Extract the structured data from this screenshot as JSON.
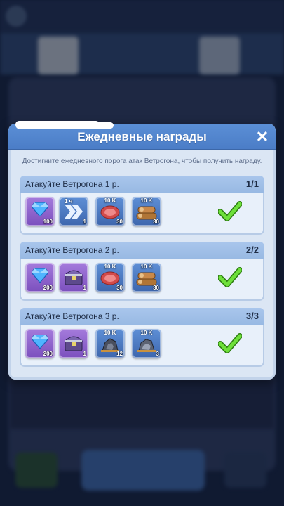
{
  "dialog": {
    "title": "Ежедневные награды",
    "close_icon": "close-icon",
    "subtitle": "Достигните ежедневного порога атак Ветрогона, чтобы получить награду."
  },
  "rows": [
    {
      "label": "Атакуйте Ветрогона 1 р.",
      "count": "1/1",
      "items": [
        {
          "icon": "blue-gem-icon",
          "qty": "100"
        },
        {
          "icon": "speedup-arrows-icon",
          "tag": "1 ч",
          "qty": "1"
        },
        {
          "icon": "meat-icon",
          "top": "10 K",
          "qty": "30"
        },
        {
          "icon": "wood-logs-icon",
          "top": "10 K",
          "qty": "30"
        }
      ],
      "completed_icon": "green-checkmark-icon"
    },
    {
      "label": "Атакуйте Ветрогона 2 р.",
      "count": "2/2",
      "items": [
        {
          "icon": "blue-gem-icon",
          "qty": "200"
        },
        {
          "icon": "treasure-chest-icon",
          "qty": "1"
        },
        {
          "icon": "meat-icon",
          "top": "10 K",
          "qty": "30"
        },
        {
          "icon": "wood-logs-icon",
          "top": "10 K",
          "qty": "30"
        }
      ],
      "completed_icon": "green-checkmark-icon"
    },
    {
      "label": "Атакуйте Ветрогона 3 р.",
      "count": "3/3",
      "items": [
        {
          "icon": "blue-gem-icon",
          "qty": "200"
        },
        {
          "icon": "treasure-chest-icon",
          "qty": "1"
        },
        {
          "icon": "iron-ore-icon",
          "top": "10 K",
          "qty": "12"
        },
        {
          "icon": "stone-ore-icon",
          "top": "10 K",
          "qty": "3"
        }
      ],
      "completed_icon": "green-checkmark-icon"
    }
  ],
  "colors": {
    "header_blue": "#4a7cc6",
    "check_green": "#5ccf2f",
    "purple_slot": "#7b4fbd",
    "blue_slot": "#3d66ad"
  }
}
